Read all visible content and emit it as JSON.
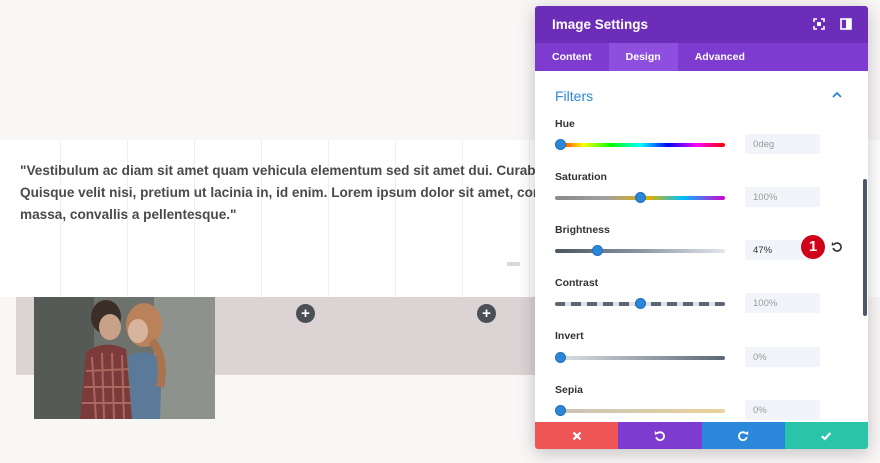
{
  "page": {
    "quote_lines": [
      "\"Vestibulum ac diam sit amet quam vehicula elementum sed sit amet dui. Curabitur aliquet quam",
      "Quisque velit nisi, pretium ut lacinia in, id enim. Lorem ipsum dolor sit amet, consectetur adipisci",
      "massa, convallis a pellentesque.\""
    ],
    "add_buttons": [
      "+",
      "+"
    ]
  },
  "panel": {
    "title": "Image Settings",
    "tabs": [
      {
        "label": "Content",
        "active": false
      },
      {
        "label": "Design",
        "active": true
      },
      {
        "label": "Advanced",
        "active": false
      }
    ],
    "section_title": "Filters",
    "filters": [
      {
        "label": "Hue",
        "value": "0deg",
        "position": 0.0
      },
      {
        "label": "Saturation",
        "value": "100%",
        "position": 0.5
      },
      {
        "label": "Brightness",
        "value": "47%",
        "position": 0.235
      },
      {
        "label": "Contrast",
        "value": "100%",
        "position": 0.5
      },
      {
        "label": "Invert",
        "value": "0%",
        "position": 0.0
      },
      {
        "label": "Sepia",
        "value": "0%",
        "position": 0.0
      }
    ],
    "badge": "1",
    "colors": {
      "header": "#6c2eb9",
      "tabs": "#7e3bd0",
      "accent": "#2b87da",
      "cancel": "#ef5555",
      "undo": "#7e3bd0",
      "redo": "#2b87da",
      "save": "#29c4a9"
    },
    "footer_icons": [
      "close-icon",
      "undo-icon",
      "redo-icon",
      "check-icon"
    ]
  }
}
